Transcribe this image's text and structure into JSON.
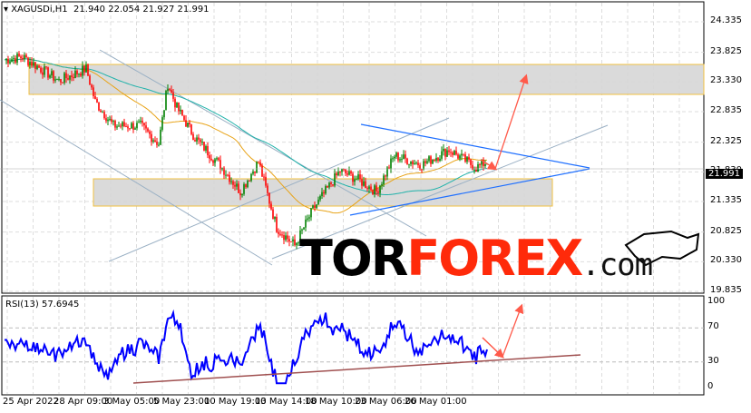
{
  "header": {
    "symbol": "XAGUSDi,H1",
    "ohlc": "21.940 22.054 21.927 21.991"
  },
  "price_axis": {
    "ticks": [
      "24.335",
      "23.825",
      "23.330",
      "22.835",
      "22.325",
      "21.830",
      "21.335",
      "20.825",
      "20.330",
      "19.835"
    ],
    "current": "21.991"
  },
  "rsi": {
    "label": "RSI(13) 57.6945",
    "ticks": [
      "100",
      "70",
      "30",
      "0"
    ]
  },
  "time_axis": [
    "25 Apr 2022",
    "28 Apr 09:00",
    "3 May 05:00",
    "5 May 23:00",
    "10 May 19:00",
    "13 May 14:00",
    "18 May 10:00",
    "23 May 06:00",
    "26 May 01:00"
  ],
  "logo": {
    "tor": "TOR",
    "forex": "FOREX",
    ".com": ".com"
  },
  "colors": {
    "bull": "#008000",
    "bear": "#ff0000",
    "ma_fast": "#e8a317",
    "ma_slow": "#20b2aa",
    "rsi": "#0000ff",
    "arrow": "#ff5a4a",
    "trend": "#1e6fff"
  },
  "chart_data": {
    "type": "candlestick",
    "ylim": [
      19.835,
      24.335
    ],
    "price_path": [
      [
        0,
        23.7
      ],
      [
        10,
        23.75
      ],
      [
        30,
        23.35
      ],
      [
        45,
        23.55
      ],
      [
        50,
        23.0
      ],
      [
        60,
        22.6
      ],
      [
        75,
        22.6
      ],
      [
        85,
        22.3
      ],
      [
        90,
        23.3
      ],
      [
        95,
        22.9
      ],
      [
        105,
        22.4
      ],
      [
        120,
        21.9
      ],
      [
        130,
        21.5
      ],
      [
        140,
        22.0
      ],
      [
        150,
        20.9
      ],
      [
        160,
        20.6
      ],
      [
        170,
        21.2
      ],
      [
        185,
        21.85
      ],
      [
        195,
        21.7
      ],
      [
        205,
        21.5
      ],
      [
        215,
        22.1
      ],
      [
        230,
        21.95
      ],
      [
        245,
        22.2
      ],
      [
        260,
        21.9
      ],
      [
        266,
        22.0
      ]
    ],
    "rsi_ylim": [
      0,
      100
    ]
  }
}
